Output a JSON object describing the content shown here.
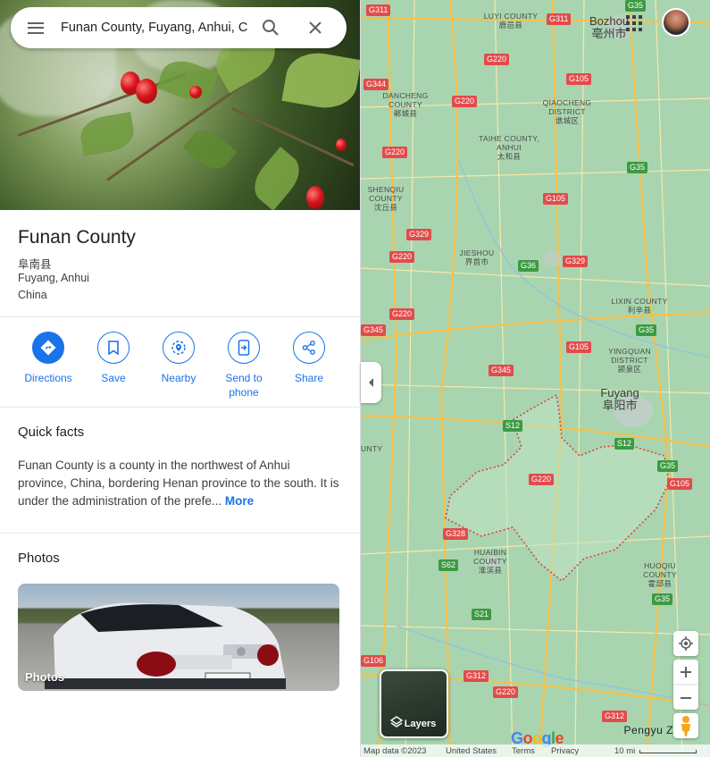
{
  "search": {
    "value": "Funan County, Fuyang, Anhui, China",
    "menu_icon": "menu-icon",
    "search_icon": "search-icon",
    "clear_icon": "close-icon"
  },
  "place": {
    "name": "Funan County",
    "native_name": "阜南县",
    "region": "Fuyang, Anhui",
    "country": "China"
  },
  "actions": [
    {
      "label": "Directions",
      "icon": "directions-icon"
    },
    {
      "label": "Save",
      "icon": "bookmark-icon"
    },
    {
      "label": "Nearby",
      "icon": "nearby-icon"
    },
    {
      "label": "Send to phone",
      "icon": "send-to-phone-icon"
    },
    {
      "label": "Share",
      "icon": "share-icon"
    }
  ],
  "quick_facts": {
    "heading": "Quick facts",
    "text": "Funan County is a county in the northwest of Anhui province, China, bordering Henan province to the south. It is under the administration of the prefe...",
    "more_label": "More"
  },
  "photos": {
    "heading": "Photos",
    "tile_label": "Photos"
  },
  "map": {
    "cities": [
      {
        "en": "Bozhou",
        "zh": "亳州市"
      },
      {
        "en": "Fuyang",
        "zh": "阜阳市"
      }
    ],
    "county_labels": [
      {
        "en": "LUYI COUNTY",
        "zh": "鹿邑县"
      },
      {
        "en": "DANCHENG COUNTY",
        "zh": "郸城县"
      },
      {
        "en": "QIAOCHENG DISTRICT",
        "zh": "谯城区"
      },
      {
        "en": "TAIHE COUNTY, ANHUI",
        "zh": "太和县"
      },
      {
        "en": "SHENQIU COUNTY",
        "zh": "沈丘县"
      },
      {
        "en": "JIESHOU",
        "zh": "界首市"
      },
      {
        "en": "LIXIN COUNTY",
        "zh": "利辛县"
      },
      {
        "en": "YINGQUAN DISTRICT",
        "zh": "颍泉区"
      },
      {
        "en": "HUAIBIN COUNTY",
        "zh": "淮滨县"
      },
      {
        "en": "HUOQIU COUNTY",
        "zh": "霍邱县"
      },
      {
        "en": "UNTY",
        "zh": ""
      }
    ],
    "highways": [
      "G311",
      "G311",
      "G35",
      "G220",
      "G344",
      "G220",
      "G105",
      "G220",
      "G35",
      "G105",
      "G329",
      "G220",
      "G36",
      "G329",
      "G220",
      "G345",
      "G105",
      "G35",
      "G345",
      "S12",
      "S12",
      "G220",
      "G35",
      "G105",
      "G328",
      "S62",
      "S21",
      "G106",
      "G312",
      "G220",
      "G312",
      "G35"
    ],
    "layers_label": "Layers",
    "bottom_right_label": "Pengyu  Zhao",
    "attribution": {
      "data": "Map data ©2023",
      "region": "United States",
      "terms": "Terms",
      "privacy": "Privacy",
      "scale": "10 mi"
    },
    "colors": {
      "land": "#a8d5b0",
      "highway_shield": "#e24b4b",
      "provincial_shield": "#3d9a44",
      "county_border": "#e04040",
      "road": "#f7c75a",
      "accent": "#1a73e8"
    }
  }
}
